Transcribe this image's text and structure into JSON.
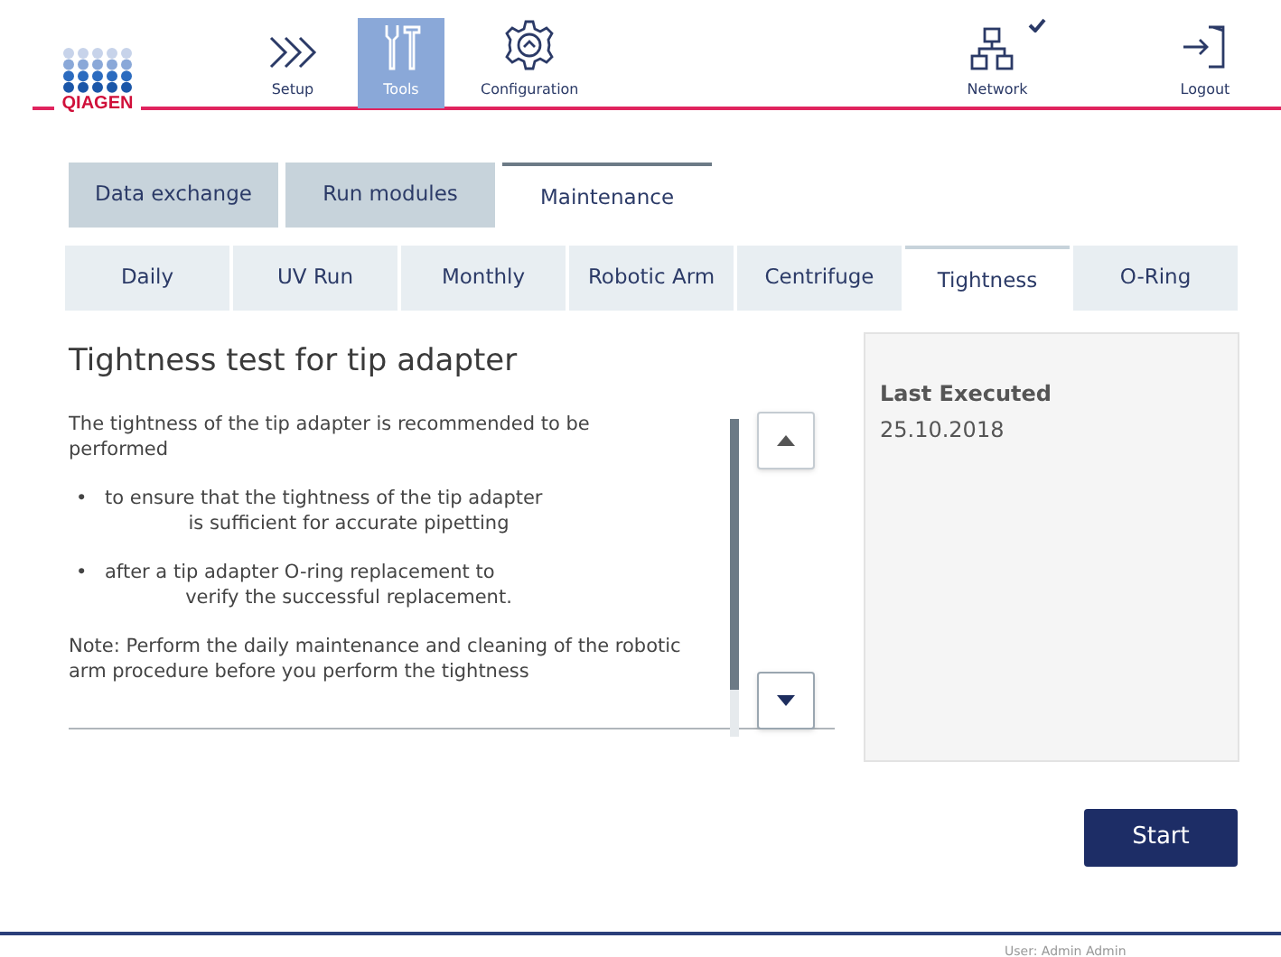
{
  "header": {
    "logo": "QIAGEN",
    "nav": [
      {
        "label": "Setup",
        "kind": "chevrons",
        "selected": false
      },
      {
        "label": "Tools",
        "kind": "tools",
        "selected": true
      },
      {
        "label": "Configuration",
        "kind": "gear",
        "selected": false
      }
    ],
    "right": [
      {
        "label": "Network",
        "kind": "network",
        "connected": true
      },
      {
        "label": "Logout",
        "kind": "logout",
        "connected": false
      }
    ]
  },
  "tabs": [
    {
      "label": "Data exchange",
      "selected": false
    },
    {
      "label": "Run modules",
      "selected": false
    },
    {
      "label": "Maintenance",
      "selected": true
    }
  ],
  "subtabs": [
    {
      "label": "Daily",
      "selected": false
    },
    {
      "label": "UV Run",
      "selected": false
    },
    {
      "label": "Monthly",
      "selected": false
    },
    {
      "label": "Robotic Arm",
      "selected": false
    },
    {
      "label": "Centrifuge",
      "selected": false
    },
    {
      "label": "Tightness",
      "selected": true
    },
    {
      "label": "O-Ring",
      "selected": false
    }
  ],
  "title": "Tightness test for tip adapter",
  "intro": "The tightness of the tip adapter is recommended to be performed",
  "bullets": [
    {
      "bullet": "•",
      "first": "to ensure that the tightness of the tip adapter",
      "second": "is sufficient for accurate pipetting"
    },
    {
      "bullet": "•",
      "first": "after a tip adapter O-ring replacement to",
      "second": "verify the successful replacement."
    }
  ],
  "note": "Note: Perform the daily maintenance and cleaning of the robotic arm procedure before you perform the tightness",
  "info": {
    "heading": "Last Executed",
    "value": "25.10.2018"
  },
  "start_button": "Start",
  "footer": "User: Admin Admin"
}
